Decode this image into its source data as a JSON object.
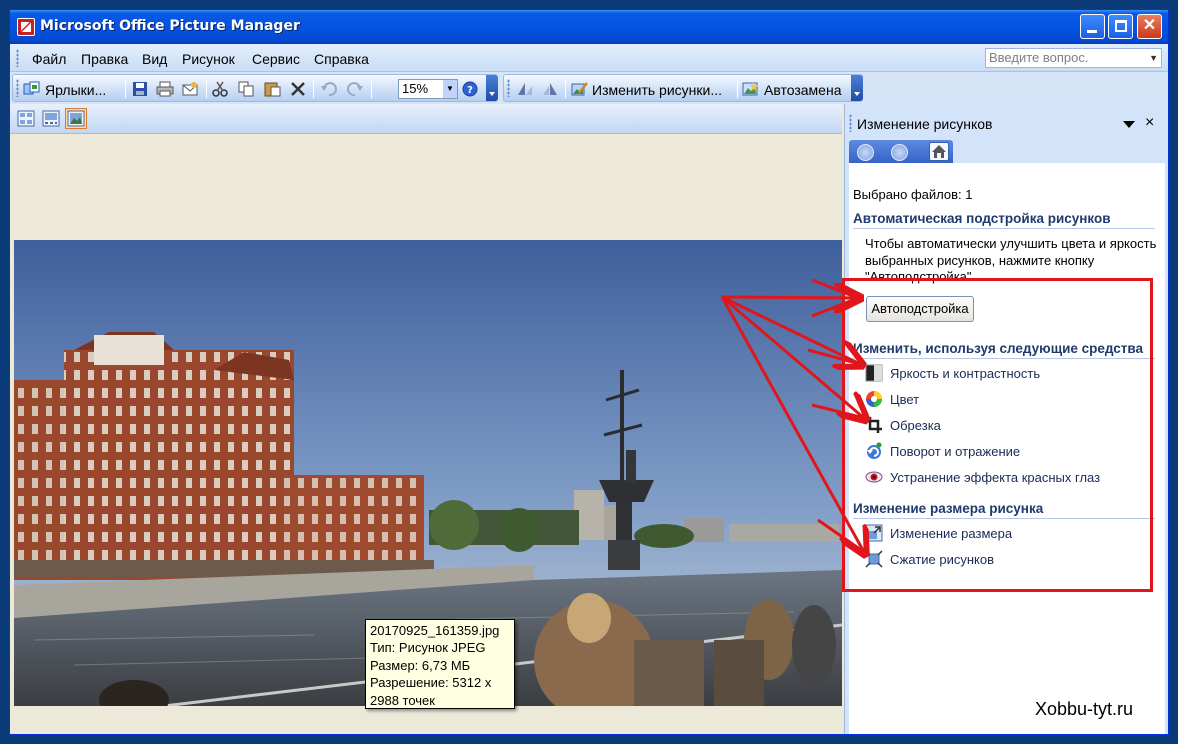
{
  "window": {
    "title": "Microsoft Office Picture Manager"
  },
  "menu": {
    "items": [
      "Файл",
      "Правка",
      "Вид",
      "Рисунок",
      "Сервис",
      "Справка"
    ],
    "help_placeholder": "Введите вопрос."
  },
  "toolbar": {
    "shortcuts_label": "Ярлыки...",
    "zoom": "15%",
    "edit_pictures_label": "Изменить рисунки...",
    "autocorrect_label": "Автозамена"
  },
  "tooltip": {
    "lines": [
      "20170925_161359.jpg",
      "Тип: Рисунок JPEG",
      "Размер: 6,73 МБ",
      "Разрешение: 5312 x",
      "2988 точек"
    ]
  },
  "task_pane": {
    "title": "Изменение рисунков",
    "files_selected": "Выбрано файлов: 1",
    "auto_section": {
      "heading": "Автоматическая подстройка рисунков",
      "description": [
        "Чтобы автоматически улучшить цвета и яркость",
        "выбранных рисунков, нажмите кнопку",
        "\"Автоподстройка\"."
      ],
      "button": "Автоподстройка"
    },
    "edit_section": {
      "heading": "Изменить, используя следующие средства",
      "tools": [
        {
          "label": "Яркость и контрастность",
          "icon": "brightness-contrast-icon"
        },
        {
          "label": "Цвет",
          "icon": "color-wheel-icon"
        },
        {
          "label": "Обрезка",
          "icon": "crop-icon"
        },
        {
          "label": "Поворот и отражение",
          "icon": "rotate-flip-icon"
        },
        {
          "label": "Устранение эффекта красных глаз",
          "icon": "red-eye-icon"
        }
      ]
    },
    "resize_section": {
      "heading": "Изменение размера рисунка",
      "tools": [
        {
          "label": "Изменение размера",
          "icon": "resize-icon"
        },
        {
          "label": "Сжатие рисунков",
          "icon": "compress-icon"
        }
      ]
    }
  },
  "watermark": "Xobbu-tyt.ru",
  "colors": {
    "annotation_red": "#e0161c",
    "titlebar_blue": "#0553e0"
  }
}
